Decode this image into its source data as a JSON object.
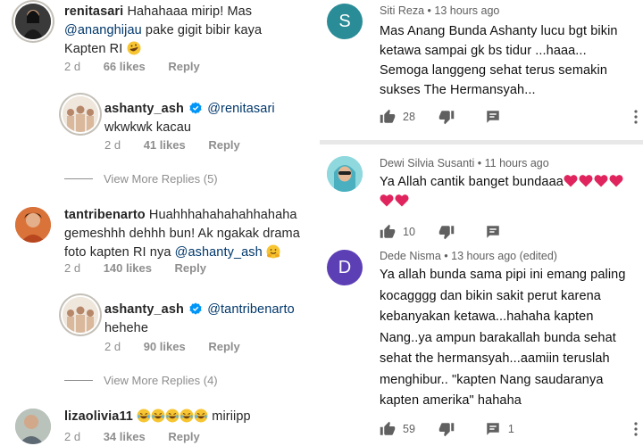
{
  "left": {
    "comments": [
      {
        "username": "renitasari",
        "text_a": "Hahahaaa mirip! Mas",
        "mention": "@ananghijau",
        "text_b": "pake gigit bibir kaya",
        "text_c": "Kapten RI",
        "time": "2 d",
        "likes": "66 likes",
        "reply": "Reply"
      },
      {
        "username": "ashanty_ash",
        "mention": "@renitasari",
        "text": "wkwkwk kacau",
        "time": "2 d",
        "likes": "41 likes",
        "reply": "Reply"
      },
      {
        "view_more": "View More Replies (5)"
      },
      {
        "username": "tantribenarto",
        "text_a": "Huahhhahahahahhahaha",
        "text_b": "gemeshhh dehhh bun! Ak ngakak drama",
        "text_c": "foto kapten RI nya",
        "mention": "@ashanty_ash",
        "time": "2 d",
        "likes": "140 likes",
        "reply": "Reply"
      },
      {
        "username": "ashanty_ash",
        "mention": "@tantribenarto",
        "text": "hehehe",
        "time": "2 d",
        "likes": "90 likes",
        "reply": "Reply"
      },
      {
        "view_more": "View More Replies (4)"
      },
      {
        "username": "lizaolivia11",
        "text": "miriipp",
        "time": "2 d",
        "likes": "34 likes",
        "reply": "Reply"
      }
    ]
  },
  "right": {
    "comments": [
      {
        "initial": "S",
        "avatar_color": "#2a8c97",
        "author": "Siti Reza",
        "time": "13 hours ago",
        "lines": [
          "Mas Anang Bunda Ashanty lucu bgt bikin",
          "ketawa sampai gk bs tidur ...haaa...",
          "Semoga langgeng sehat terus semakin",
          "sukses The Hermansyah..."
        ],
        "like_count": "28"
      },
      {
        "author": "Dewi Silvia Susanti",
        "time": "11 hours ago",
        "lines": [
          "Ya Allah cantik banget bundaaa"
        ],
        "like_count": "10"
      },
      {
        "initial": "D",
        "avatar_color": "#5c3fb5",
        "author": "Dede Nisma",
        "time": "13 hours ago (edited)",
        "lines": [
          "Ya allah bunda sama pipi ini emang paling",
          "kocagggg dan bikin sakit perut karena",
          "kebanyakan ketawa...hahaha kapten",
          "Nang..ya ampun barakallah bunda sehat",
          "sehat the hermansyah...aamiin teruslah",
          "menghibur.. \"kapten Nang saudaranya",
          "kapten amerika\" hahaha"
        ],
        "like_count": "59",
        "reply_count": "1"
      }
    ],
    "separator": "•"
  },
  "colors": {
    "ig_mention": "#00376b",
    "ig_meta": "#8e8e8e",
    "yt_meta": "#606060",
    "verified": "#0095f6",
    "heart": "#e0245e"
  }
}
